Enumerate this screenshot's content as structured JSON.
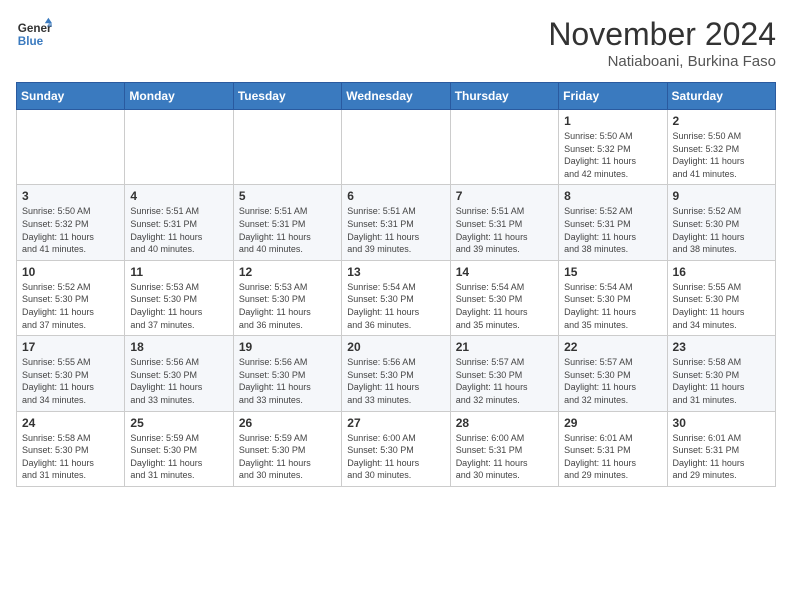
{
  "header": {
    "logo_line1": "General",
    "logo_line2": "Blue",
    "month_title": "November 2024",
    "location": "Natiaboani, Burkina Faso"
  },
  "weekdays": [
    "Sunday",
    "Monday",
    "Tuesday",
    "Wednesday",
    "Thursday",
    "Friday",
    "Saturday"
  ],
  "weeks": [
    [
      {
        "day": "",
        "info": ""
      },
      {
        "day": "",
        "info": ""
      },
      {
        "day": "",
        "info": ""
      },
      {
        "day": "",
        "info": ""
      },
      {
        "day": "",
        "info": ""
      },
      {
        "day": "1",
        "info": "Sunrise: 5:50 AM\nSunset: 5:32 PM\nDaylight: 11 hours\nand 42 minutes."
      },
      {
        "day": "2",
        "info": "Sunrise: 5:50 AM\nSunset: 5:32 PM\nDaylight: 11 hours\nand 41 minutes."
      }
    ],
    [
      {
        "day": "3",
        "info": "Sunrise: 5:50 AM\nSunset: 5:32 PM\nDaylight: 11 hours\nand 41 minutes."
      },
      {
        "day": "4",
        "info": "Sunrise: 5:51 AM\nSunset: 5:31 PM\nDaylight: 11 hours\nand 40 minutes."
      },
      {
        "day": "5",
        "info": "Sunrise: 5:51 AM\nSunset: 5:31 PM\nDaylight: 11 hours\nand 40 minutes."
      },
      {
        "day": "6",
        "info": "Sunrise: 5:51 AM\nSunset: 5:31 PM\nDaylight: 11 hours\nand 39 minutes."
      },
      {
        "day": "7",
        "info": "Sunrise: 5:51 AM\nSunset: 5:31 PM\nDaylight: 11 hours\nand 39 minutes."
      },
      {
        "day": "8",
        "info": "Sunrise: 5:52 AM\nSunset: 5:31 PM\nDaylight: 11 hours\nand 38 minutes."
      },
      {
        "day": "9",
        "info": "Sunrise: 5:52 AM\nSunset: 5:30 PM\nDaylight: 11 hours\nand 38 minutes."
      }
    ],
    [
      {
        "day": "10",
        "info": "Sunrise: 5:52 AM\nSunset: 5:30 PM\nDaylight: 11 hours\nand 37 minutes."
      },
      {
        "day": "11",
        "info": "Sunrise: 5:53 AM\nSunset: 5:30 PM\nDaylight: 11 hours\nand 37 minutes."
      },
      {
        "day": "12",
        "info": "Sunrise: 5:53 AM\nSunset: 5:30 PM\nDaylight: 11 hours\nand 36 minutes."
      },
      {
        "day": "13",
        "info": "Sunrise: 5:54 AM\nSunset: 5:30 PM\nDaylight: 11 hours\nand 36 minutes."
      },
      {
        "day": "14",
        "info": "Sunrise: 5:54 AM\nSunset: 5:30 PM\nDaylight: 11 hours\nand 35 minutes."
      },
      {
        "day": "15",
        "info": "Sunrise: 5:54 AM\nSunset: 5:30 PM\nDaylight: 11 hours\nand 35 minutes."
      },
      {
        "day": "16",
        "info": "Sunrise: 5:55 AM\nSunset: 5:30 PM\nDaylight: 11 hours\nand 34 minutes."
      }
    ],
    [
      {
        "day": "17",
        "info": "Sunrise: 5:55 AM\nSunset: 5:30 PM\nDaylight: 11 hours\nand 34 minutes."
      },
      {
        "day": "18",
        "info": "Sunrise: 5:56 AM\nSunset: 5:30 PM\nDaylight: 11 hours\nand 33 minutes."
      },
      {
        "day": "19",
        "info": "Sunrise: 5:56 AM\nSunset: 5:30 PM\nDaylight: 11 hours\nand 33 minutes."
      },
      {
        "day": "20",
        "info": "Sunrise: 5:56 AM\nSunset: 5:30 PM\nDaylight: 11 hours\nand 33 minutes."
      },
      {
        "day": "21",
        "info": "Sunrise: 5:57 AM\nSunset: 5:30 PM\nDaylight: 11 hours\nand 32 minutes."
      },
      {
        "day": "22",
        "info": "Sunrise: 5:57 AM\nSunset: 5:30 PM\nDaylight: 11 hours\nand 32 minutes."
      },
      {
        "day": "23",
        "info": "Sunrise: 5:58 AM\nSunset: 5:30 PM\nDaylight: 11 hours\nand 31 minutes."
      }
    ],
    [
      {
        "day": "24",
        "info": "Sunrise: 5:58 AM\nSunset: 5:30 PM\nDaylight: 11 hours\nand 31 minutes."
      },
      {
        "day": "25",
        "info": "Sunrise: 5:59 AM\nSunset: 5:30 PM\nDaylight: 11 hours\nand 31 minutes."
      },
      {
        "day": "26",
        "info": "Sunrise: 5:59 AM\nSunset: 5:30 PM\nDaylight: 11 hours\nand 30 minutes."
      },
      {
        "day": "27",
        "info": "Sunrise: 6:00 AM\nSunset: 5:30 PM\nDaylight: 11 hours\nand 30 minutes."
      },
      {
        "day": "28",
        "info": "Sunrise: 6:00 AM\nSunset: 5:31 PM\nDaylight: 11 hours\nand 30 minutes."
      },
      {
        "day": "29",
        "info": "Sunrise: 6:01 AM\nSunset: 5:31 PM\nDaylight: 11 hours\nand 29 minutes."
      },
      {
        "day": "30",
        "info": "Sunrise: 6:01 AM\nSunset: 5:31 PM\nDaylight: 11 hours\nand 29 minutes."
      }
    ]
  ]
}
